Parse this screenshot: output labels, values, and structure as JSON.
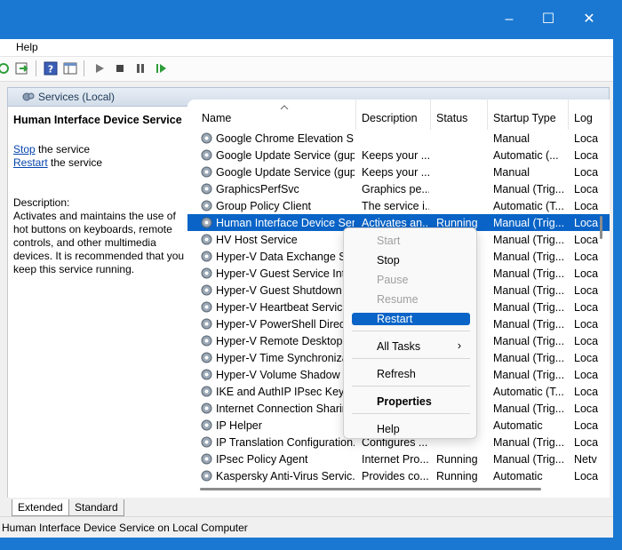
{
  "menu": {
    "help": "Help"
  },
  "pane_header": {
    "title": "Services (Local)"
  },
  "left_pane": {
    "service_title": "Human Interface Device Service",
    "stop_link": "Stop",
    "stop_suffix": " the service",
    "restart_link": "Restart",
    "restart_suffix": " the service",
    "description_label": "Description:",
    "description": "Activates and maintains the use of hot buttons on keyboards, remote controls, and other multimedia devices. It is recommended that you keep this service running."
  },
  "columns": {
    "name": "Name",
    "description": "Description",
    "status": "Status",
    "startup_type": "Startup Type",
    "log_on_as": "Log"
  },
  "services": [
    {
      "name": "Google Chrome Elevation S...",
      "description": "",
      "status": "",
      "startup": "Manual",
      "logon": "Loca"
    },
    {
      "name": "Google Update Service (gup...",
      "description": "Keeps your ...",
      "status": "",
      "startup": "Automatic (...",
      "logon": "Loca"
    },
    {
      "name": "Google Update Service (gup...",
      "description": "Keeps your ...",
      "status": "",
      "startup": "Manual",
      "logon": "Loca"
    },
    {
      "name": "GraphicsPerfSvc",
      "description": "Graphics pe...",
      "status": "",
      "startup": "Manual (Trig...",
      "logon": "Loca"
    },
    {
      "name": "Group Policy Client",
      "description": "The service i...",
      "status": "",
      "startup": "Automatic (T...",
      "logon": "Loca"
    },
    {
      "name": "Human Interface Device Ser...",
      "description": "Activates an...",
      "status": "Running",
      "startup": "Manual (Trig...",
      "logon": "Loca"
    },
    {
      "name": "HV Host Service",
      "description": "",
      "status": "",
      "startup": "Manual (Trig...",
      "logon": "Loca"
    },
    {
      "name": "Hyper-V Data Exchange Ser",
      "description": "",
      "status": "",
      "startup": "Manual (Trig...",
      "logon": "Loca"
    },
    {
      "name": "Hyper-V Guest Service Inter",
      "description": "",
      "status": "",
      "startup": "Manual (Trig...",
      "logon": "Loca"
    },
    {
      "name": "Hyper-V Guest Shutdown S",
      "description": "",
      "status": "",
      "startup": "Manual (Trig...",
      "logon": "Loca"
    },
    {
      "name": "Hyper-V Heartbeat Service",
      "description": "",
      "status": "",
      "startup": "Manual (Trig...",
      "logon": "Loca"
    },
    {
      "name": "Hyper-V PowerShell Direct",
      "description": "",
      "status": "",
      "startup": "Manual (Trig...",
      "logon": "Loca"
    },
    {
      "name": "Hyper-V Remote Desktop V",
      "description": "",
      "status": "",
      "startup": "Manual (Trig...",
      "logon": "Loca"
    },
    {
      "name": "Hyper-V Time Synchronizat",
      "description": "",
      "status": "",
      "startup": "Manual (Trig...",
      "logon": "Loca"
    },
    {
      "name": "Hyper-V Volume Shadow C",
      "description": "",
      "status": "",
      "startup": "Manual (Trig...",
      "logon": "Loca"
    },
    {
      "name": "IKE and AuthIP IPsec Keying",
      "description": "",
      "status": "",
      "startup": "Automatic (T...",
      "logon": "Loca"
    },
    {
      "name": "Internet Connection Sharin",
      "description": "",
      "status": "",
      "startup": "Manual (Trig...",
      "logon": "Loca"
    },
    {
      "name": "IP Helper",
      "description": "",
      "status": "",
      "startup": "Automatic",
      "logon": "Loca"
    },
    {
      "name": "IP Translation Configuration...",
      "description": "Configures ...",
      "status": "",
      "startup": "Manual (Trig...",
      "logon": "Loca"
    },
    {
      "name": "IPsec Policy Agent",
      "description": "Internet Pro...",
      "status": "Running",
      "startup": "Manual (Trig...",
      "logon": "Netv"
    },
    {
      "name": "Kaspersky Anti-Virus Servic...",
      "description": "Provides co...",
      "status": "Running",
      "startup": "Automatic",
      "logon": "Loca"
    }
  ],
  "context_menu": {
    "start": "Start",
    "stop": "Stop",
    "pause": "Pause",
    "resume": "Resume",
    "restart": "Restart",
    "all_tasks": "All Tasks",
    "all_tasks_arrow": "›",
    "refresh": "Refresh",
    "properties": "Properties",
    "help": "Help"
  },
  "tabs": {
    "extended": "Extended",
    "standard": "Standard"
  },
  "status_bar": {
    "text": "Human Interface Device Service on Local Computer"
  },
  "colors": {
    "accent": "#1a78d2",
    "selection": "#0a64c7",
    "link": "#0645ad"
  }
}
